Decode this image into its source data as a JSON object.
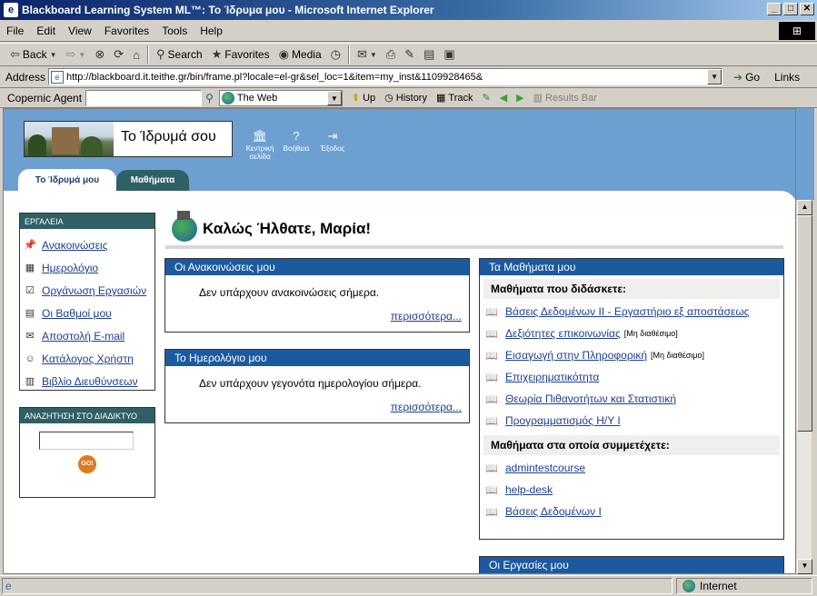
{
  "window": {
    "title": "Blackboard Learning System ML™: Το Ίδρυμα μου - Microsoft Internet Explorer",
    "min": "_",
    "max": "□",
    "close": "✕"
  },
  "menu": [
    "File",
    "Edit",
    "View",
    "Favorites",
    "Tools",
    "Help"
  ],
  "toolbar": {
    "back": "Back",
    "search": "Search",
    "favorites": "Favorites",
    "media": "Media"
  },
  "address": {
    "label": "Address",
    "url": "http://blackboard.it.teithe.gr/bin/frame.pl?locale=el-gr&sel_loc=1&item=my_inst&1109928465&",
    "go": "Go",
    "links": "Links"
  },
  "copernic": {
    "label": "Copernic Agent",
    "scope": "The Web",
    "up": "Up",
    "history": "History",
    "track": "Track",
    "results": "Results Bar"
  },
  "header": {
    "banner_title": "Το Ίδρυμά σου",
    "icons": [
      {
        "label": "Κεντρική σελίδα"
      },
      {
        "label": "Βοήθεια"
      },
      {
        "label": "Έξοδος"
      }
    ]
  },
  "tabs": [
    {
      "label": "Το Ίδρυμά μου"
    },
    {
      "label": "Μαθήματα"
    }
  ],
  "tools": {
    "header": "ΕΡΓΑΛΕΙΑ",
    "items": [
      {
        "label": "Ανακοινώσεις",
        "icon": "pin-icon"
      },
      {
        "label": "Ημερολόγιο",
        "icon": "calendar-icon"
      },
      {
        "label": "Οργάνωση Εργασιών",
        "icon": "tasks-icon"
      },
      {
        "label": "Οι Βαθμοί μου",
        "icon": "grades-icon"
      },
      {
        "label": "Αποστολή E-mail",
        "icon": "email-icon"
      },
      {
        "label": "Κατάλογος Χρήστη",
        "icon": "user-directory-icon"
      },
      {
        "label": "Βιβλίο Διευθύνσεων",
        "icon": "address-book-icon"
      }
    ]
  },
  "search": {
    "header": "ΑΝΑΖΗΤΗΣΗ ΣΤΟ ΔΙΑΔΙΚΤΥΟ",
    "value": "",
    "go": "GO!"
  },
  "welcome": "Καλώς Ήλθατε, Μαρία!",
  "announcements": {
    "title": "Οι Ανακοινώσεις μου",
    "text": "Δεν υπάρχουν ανακοινώσεις σήμερα.",
    "more": "περισσότερα..."
  },
  "calendar": {
    "title": "Το Ημερολόγιο μου",
    "text": "Δεν υπάρχουν γεγονότα ημερολογίου σήμερα.",
    "more": "περισσότερα..."
  },
  "courses": {
    "title": "Τα Μαθήματα μου",
    "teaching_header": "Μαθήματα που διδάσκετε:",
    "teaching": [
      {
        "name": "Βάσεις Δεδομένων ΙΙ - Εργαστήριο εξ αποστάσεως",
        "note": ""
      },
      {
        "name": "Δεξιότητες επικοινωνίας",
        "note": "[Μη διαθέσιμο]"
      },
      {
        "name": "Εισαγωγή στην Πληροφορική",
        "note": "[Μη διαθέσιμο]"
      },
      {
        "name": "Επιχειρηματικότητα",
        "note": ""
      },
      {
        "name": "Θεωρία Πιθανοτήτων και Στατιστική",
        "note": ""
      },
      {
        "name": "Προγραμματισμός Η/Υ Ι",
        "note": ""
      }
    ],
    "participating_header": "Μαθήματα στα οποία συμμετέχετε:",
    "participating": [
      {
        "name": "admintestcourse"
      },
      {
        "name": "help-desk"
      },
      {
        "name": "Βάσεις Δεδομένων Ι"
      }
    ]
  },
  "tasks": {
    "title": "Οι Εργασίες μου"
  },
  "status": {
    "zone": "Internet"
  }
}
